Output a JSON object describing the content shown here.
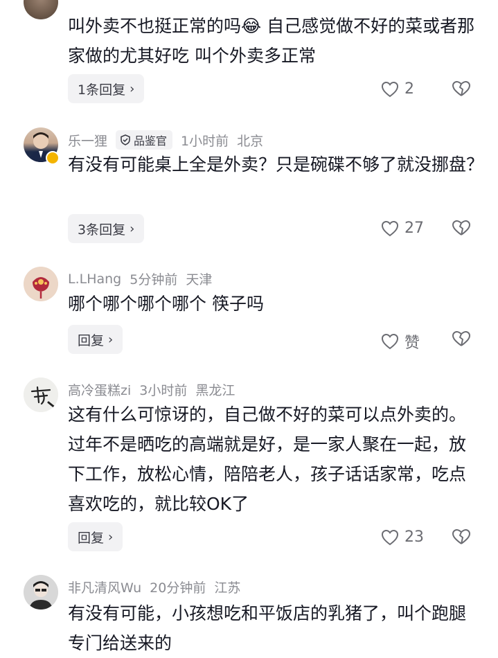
{
  "comments": [
    {
      "text": "叫外卖不也挺正常的吗😂 自己感觉做不好的菜或者那家做的尤其好吃 叫个外卖多正常",
      "reply_label": "1条回复",
      "like_count": "2"
    },
    {
      "username": "乐一狸",
      "badge": "品鉴官",
      "time": "1小时前",
      "location": "北京",
      "text": "有没有可能桌上全是外卖？只是碗碟不够了就没挪盘？",
      "reply_label": "3条回复",
      "like_count": "27"
    },
    {
      "username": "L.LHang",
      "time": "5分钟前",
      "location": "天津",
      "text": "哪个哪个哪个哪个 筷子吗",
      "reply_label": "回复",
      "like_count": "赞"
    },
    {
      "username": "高冷蛋糕zi",
      "time": "3小时前",
      "location": "黑龙江",
      "text": "这有什么可惊讶的，自己做不好的菜可以点外卖的。过年不是晒吃的高端就是好，是一家人聚在一起，放下工作，放松心情，陪陪老人，孩子话话家常，吃点喜欢吃的，就比较OK了",
      "reply_label": "回复",
      "like_count": "23"
    },
    {
      "username": "非凡清风Wu",
      "time": "20分钟前",
      "location": "江苏",
      "text": "有没有可能，小孩想吃和平饭店的乳猪了，叫个跑腿专门给送来的"
    }
  ],
  "icons": {
    "like": "heart-outline-icon",
    "dislike": "broken-heart-icon",
    "chevron": "chevron-right-icon"
  },
  "colors": {
    "meta": "#8a8b91",
    "pill_bg": "#f2f2f4",
    "text": "#161823"
  }
}
